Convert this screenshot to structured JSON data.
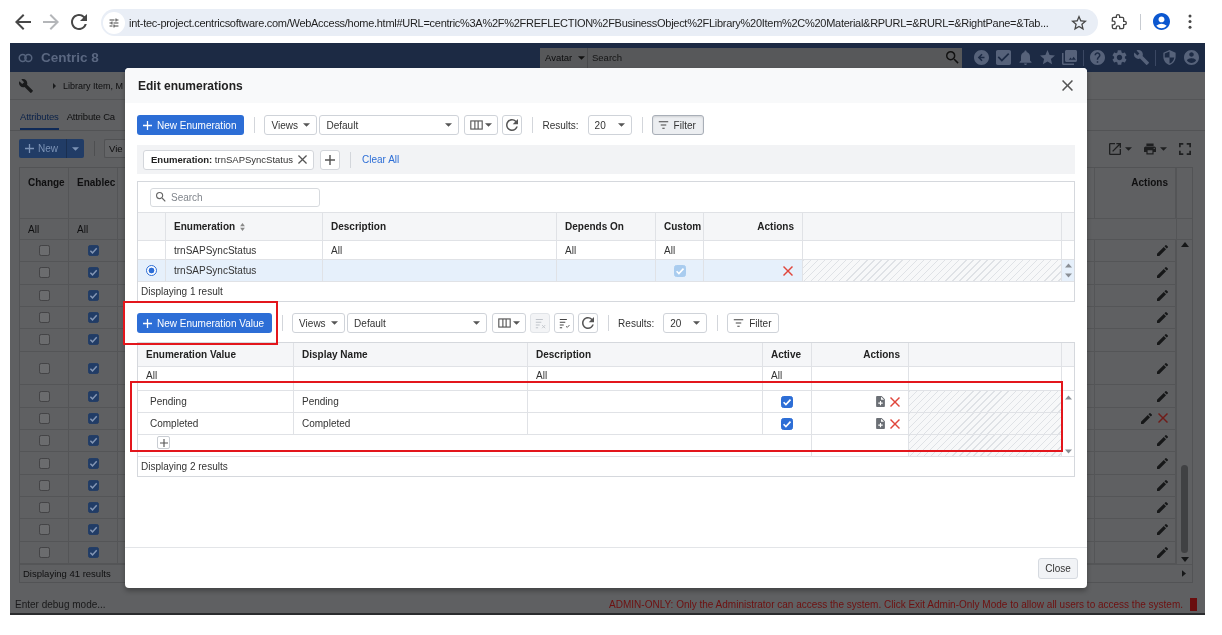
{
  "browser": {
    "url": "int-tec-project.centricsoftware.com/WebAccess/home.html#URL=centric%3A%2F%2FREFLECTION%2FBusinessObject%2FLibrary%20Item%2C%20Material&RPURL=&RURL=&RightPane=&Tab...",
    "can_go_forward": false
  },
  "app": {
    "brand": "Centric 8",
    "search": {
      "scope": "Avatar",
      "placeholder": "Search"
    },
    "breadcrumb": "Library Item, M",
    "tabs": [
      {
        "label": "Attributes",
        "selected": true
      },
      {
        "label": "Attribute Ca",
        "selected": false
      }
    ],
    "toolbar": {
      "new_button": "New",
      "views_button": "Vie"
    },
    "table": {
      "columns": [
        {
          "label": "Change",
          "filter": "All"
        },
        {
          "label": "Enablec",
          "filter": "All"
        }
      ],
      "actions_header": "Actions",
      "rows": [
        {
          "change": false,
          "enabled": true,
          "deletable": false
        },
        {
          "change": false,
          "enabled": true,
          "deletable": false
        },
        {
          "change": false,
          "enabled": true,
          "deletable": false
        },
        {
          "change": false,
          "enabled": true,
          "deletable": false
        },
        {
          "change": false,
          "enabled": true,
          "deletable": false
        },
        {
          "change": false,
          "enabled": true,
          "deletable": false
        },
        {
          "change": false,
          "enabled": true,
          "deletable": false
        },
        {
          "change": false,
          "enabled": true,
          "deletable": true
        },
        {
          "change": false,
          "enabled": true,
          "deletable": false
        },
        {
          "change": false,
          "enabled": true,
          "deletable": false
        },
        {
          "change": false,
          "enabled": true,
          "deletable": false
        },
        {
          "change": false,
          "enabled": true,
          "deletable": false
        },
        {
          "change": false,
          "enabled": true,
          "deletable": false
        },
        {
          "change": false,
          "enabled": true,
          "deletable": false
        }
      ],
      "footer": "Displaying 41 results"
    }
  },
  "dialog": {
    "title": "Edit enumerations",
    "enumerations": {
      "toolbar": {
        "new_button": "New Enumeration",
        "views": "Views",
        "view": "Default",
        "results_label": "Results:",
        "results": "20",
        "filter": {
          "label": "Filter",
          "pressed": true
        }
      },
      "chips": [
        {
          "label": "Enumeration:",
          "value": "trnSAPSyncStatus"
        }
      ],
      "clear_all": "Clear All",
      "search_placeholder": "Search",
      "columns": [
        {
          "label": "Enumeration",
          "sortable": true,
          "filter": "trnSAPSyncStatus"
        },
        {
          "label": "Description",
          "sortable": false,
          "filter": "All"
        },
        {
          "label": "Depends On",
          "sortable": false,
          "filter": "All"
        },
        {
          "label": "Custom",
          "sortable": false,
          "filter": "All"
        },
        {
          "label": "Actions",
          "sortable": false
        }
      ],
      "rows": [
        {
          "enumeration": "trnSAPSyncStatus",
          "selected": true,
          "custom": true
        }
      ],
      "footer": "Displaying 1 result"
    },
    "values": {
      "toolbar": {
        "new_button": "New Enumeration Value",
        "views": "Views",
        "view": "Default",
        "clear_sort_disabled": true,
        "results_label": "Results:",
        "results": "20",
        "filter": {
          "label": "Filter",
          "pressed": false
        }
      },
      "columns": [
        {
          "label": "Enumeration Value",
          "filter": "All"
        },
        {
          "label": "Display Name"
        },
        {
          "label": "Description",
          "filter": "All"
        },
        {
          "label": "Active",
          "filter": "All"
        },
        {
          "label": "Actions"
        }
      ],
      "rows": [
        {
          "value": "Pending",
          "display_name": "Pending",
          "active": true
        },
        {
          "value": "Completed",
          "display_name": "Completed",
          "active": true
        }
      ],
      "footer": "Displaying 2 results"
    },
    "close_button": "Close"
  },
  "status_bar": {
    "debug_placeholder": "Enter debug mode...",
    "message": "ADMIN-ONLY: Only the Administrator can access the system. Click Exit Admin-Only Mode to allow all users to access the system."
  }
}
